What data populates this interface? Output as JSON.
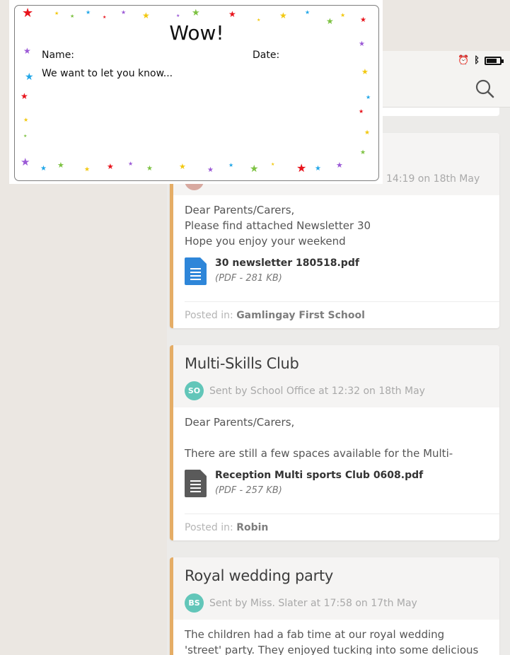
{
  "wow_card": {
    "title": "Wow!",
    "name_label": "Name:",
    "date_label": "Date:",
    "message": "We want to let you know..."
  },
  "status_bar": {
    "alarm_icon": "alarm-icon",
    "bluetooth_icon": "bluetooth-icon",
    "battery_icon": "battery-icon"
  },
  "app_bar": {
    "search_icon": "search-icon"
  },
  "posts": [
    {
      "title": "",
      "meta": "14:19 on 18th May",
      "body_lines": [
        "Dear Parents/Carers,",
        "Please find attached Newsletter 30",
        "Hope you enjoy your weekend"
      ],
      "attachment": {
        "name": "30 newsletter 180518.pdf",
        "size": "(PDF - 281 KB)",
        "icon_color": "#2e86d9"
      },
      "posted_label": "Posted in:",
      "posted_in": "Gamlingay First School"
    },
    {
      "title": "Multi-Skills Club",
      "avatar": "SO",
      "meta": "Sent by School Office at 12:32 on 18th May",
      "body_lines": [
        "Dear Parents/Carers,",
        "",
        "There are still a few spaces available for the Multi-"
      ],
      "attachment": {
        "name": "Reception Multi sports Club 0608.pdf",
        "size": "(PDF - 257 KB)",
        "icon_color": "#5a5a5a"
      },
      "posted_label": "Posted in:",
      "posted_in": "Robin"
    },
    {
      "title": "Royal wedding party",
      "avatar": "BS",
      "meta": "Sent by Miss. Slater at 17:58 on 17th May",
      "body_lines": [
        "The children had a fab time at our royal wedding",
        "'street' party. They enjoyed tucking into some delicious"
      ]
    }
  ],
  "colors": {
    "accent": "#e5ad66",
    "avatar": "#62c6b9",
    "pdf_blue": "#2e86d9",
    "doc_grey": "#5a5a5a"
  }
}
